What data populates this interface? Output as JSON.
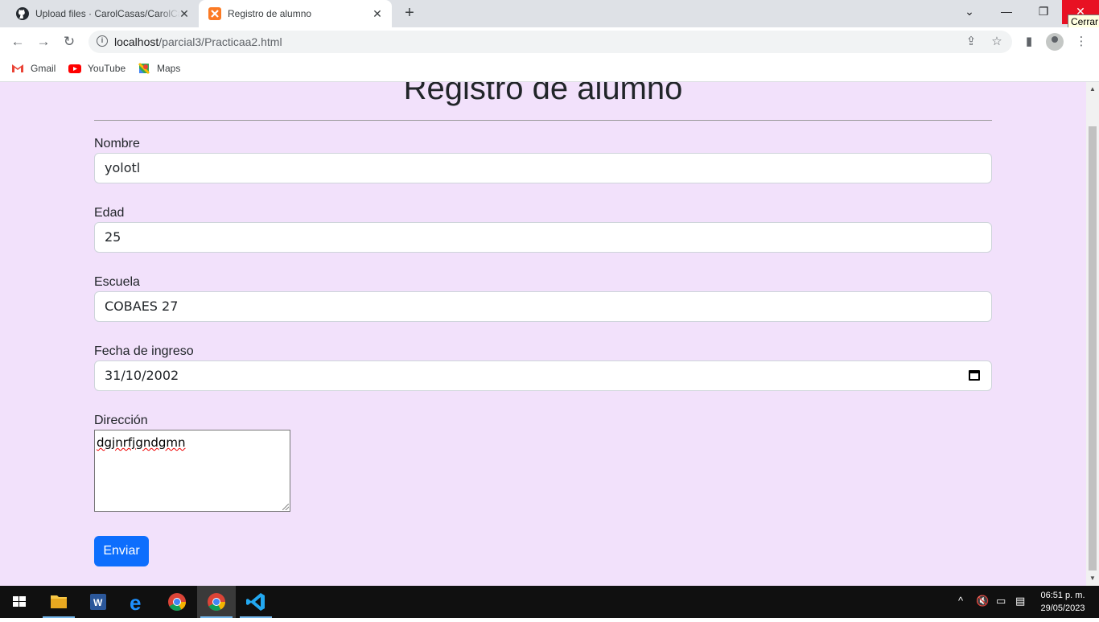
{
  "browser": {
    "tabs": [
      {
        "title": "Upload files · CarolCasas/CarolCasas"
      },
      {
        "title": "Registro de alumno"
      }
    ],
    "close_tooltip": "Cerrar",
    "url_host": "localhost",
    "url_path": "/parcial3/Practicaa2.html",
    "bookmarks": [
      "Gmail",
      "YouTube",
      "Maps"
    ]
  },
  "form": {
    "heading": "Registro de alumno",
    "nombre_label": "Nombre",
    "nombre_value": "yolotl",
    "edad_label": "Edad",
    "edad_value": "25",
    "escuela_label": "Escuela",
    "escuela_value": "COBAES 27",
    "fecha_label": "Fecha de ingreso",
    "fecha_value": "31/10/2002",
    "direccion_label": "Dirección",
    "direccion_value": "dgjnrfjgndgmn",
    "submit_label": "Enviar"
  },
  "colors": {
    "page_bg": "#f2e1fb",
    "button_bg": "#0d6efd",
    "close_bg": "#e81123"
  },
  "taskbar": {
    "time": "06:51 p. m.",
    "date": "29/05/2023"
  }
}
